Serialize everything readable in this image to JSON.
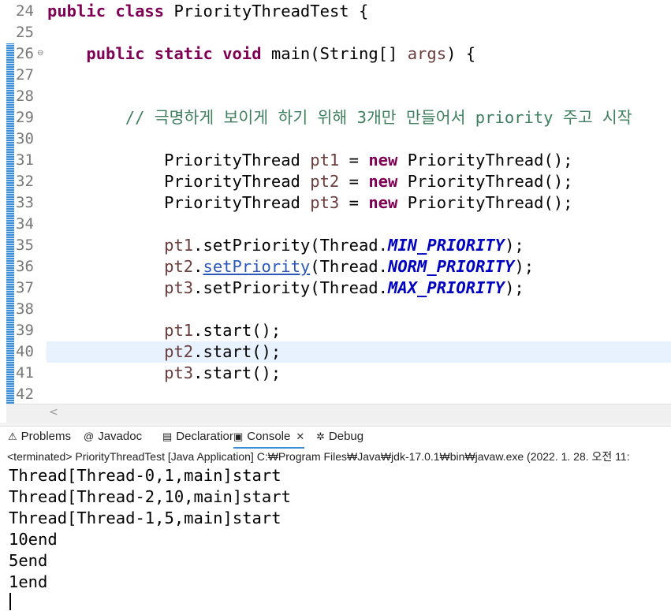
{
  "editor": {
    "lines": [
      {
        "num": "24",
        "parts": [
          [
            "kw",
            "public "
          ],
          [
            "kw",
            "class "
          ],
          [
            "",
            "PriorityThreadTest {"
          ]
        ]
      },
      {
        "num": "25",
        "parts": []
      },
      {
        "num": "26",
        "parts": [
          [
            "",
            "    "
          ],
          [
            "kw",
            "public "
          ],
          [
            "kw",
            "static "
          ],
          [
            "kw",
            "void "
          ],
          [
            "",
            "main(String[] "
          ],
          [
            "var",
            "args"
          ],
          [
            "",
            ") {"
          ]
        ]
      },
      {
        "num": "27",
        "parts": []
      },
      {
        "num": "28",
        "parts": []
      },
      {
        "num": "29",
        "parts": [
          [
            "",
            "        "
          ],
          [
            "cm",
            "// 극명하게 보이게 하기 위해 3개만 만들어서 priority 주고 시작"
          ]
        ]
      },
      {
        "num": "30",
        "parts": []
      },
      {
        "num": "31",
        "parts": [
          [
            "",
            "            PriorityThread "
          ],
          [
            "var",
            "pt1"
          ],
          [
            "",
            " = "
          ],
          [
            "kw",
            "new "
          ],
          [
            "",
            "PriorityThread();"
          ]
        ]
      },
      {
        "num": "32",
        "parts": [
          [
            "",
            "            PriorityThread "
          ],
          [
            "var",
            "pt2"
          ],
          [
            "",
            " = "
          ],
          [
            "kw",
            "new "
          ],
          [
            "",
            "PriorityThread();"
          ]
        ]
      },
      {
        "num": "33",
        "parts": [
          [
            "",
            "            PriorityThread "
          ],
          [
            "var",
            "pt3"
          ],
          [
            "",
            " = "
          ],
          [
            "kw",
            "new "
          ],
          [
            "",
            "PriorityThread();"
          ]
        ]
      },
      {
        "num": "34",
        "parts": []
      },
      {
        "num": "35",
        "parts": [
          [
            "",
            "            "
          ],
          [
            "var",
            "pt1"
          ],
          [
            "",
            ".setPriority(Thread."
          ],
          [
            "const",
            "MIN_PRIORITY"
          ],
          [
            "",
            ");"
          ]
        ]
      },
      {
        "num": "36",
        "parts": [
          [
            "",
            "            "
          ],
          [
            "var",
            "pt2"
          ],
          [
            "",
            "."
          ],
          [
            "link",
            "setPriority"
          ],
          [
            "",
            "(Thread."
          ],
          [
            "const",
            "NORM_PRIORITY"
          ],
          [
            "",
            ");"
          ]
        ]
      },
      {
        "num": "37",
        "parts": [
          [
            "",
            "            "
          ],
          [
            "var",
            "pt3"
          ],
          [
            "",
            ".setPriority(Thread."
          ],
          [
            "const",
            "MAX_PRIORITY"
          ],
          [
            "",
            ");"
          ]
        ]
      },
      {
        "num": "38",
        "parts": []
      },
      {
        "num": "39",
        "parts": [
          [
            "",
            "            "
          ],
          [
            "var",
            "pt1"
          ],
          [
            "",
            ".start();"
          ]
        ]
      },
      {
        "num": "40",
        "parts": [
          [
            "",
            "            "
          ],
          [
            "var",
            "pt2"
          ],
          [
            "",
            ".start();"
          ]
        ]
      },
      {
        "num": "41",
        "parts": [
          [
            "",
            "            "
          ],
          [
            "var",
            "pt3"
          ],
          [
            "",
            ".start();"
          ]
        ]
      },
      {
        "num": "42",
        "parts": []
      }
    ],
    "fold_marker": "⊖",
    "scroll_left_arrow": "<"
  },
  "panel": {
    "tabs": [
      {
        "label": "Problems",
        "icon": "problems-icon",
        "glyph": "⚠"
      },
      {
        "label": "Javadoc",
        "icon": "javadoc-icon",
        "glyph": "@"
      },
      {
        "label": "Declaration",
        "icon": "declaration-icon",
        "glyph": "▤"
      },
      {
        "label": "Console",
        "icon": "console-icon",
        "glyph": "▣",
        "active": true,
        "close": "✕"
      },
      {
        "label": "Debug",
        "icon": "debug-icon",
        "glyph": "✲"
      }
    ],
    "status": "<terminated> PriorityThreadTest [Java Application] C:₩Program Files₩Java₩jdk-17.0.1₩bin₩javaw.exe  (2022. 1. 28. 오전 11:"
  },
  "console": {
    "output": [
      "Thread[Thread-0,1,main]start",
      "Thread[Thread-2,10,main]start",
      "Thread[Thread-1,5,main]start",
      "10end",
      "5end",
      "1end"
    ]
  }
}
